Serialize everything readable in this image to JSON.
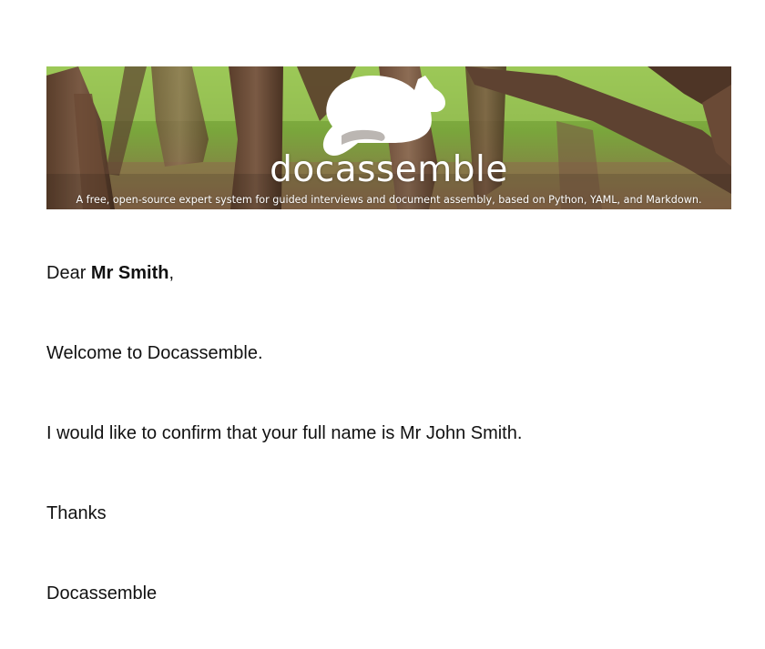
{
  "banner": {
    "logo_icon": "cat-icon",
    "logo_text": "docassemble",
    "tagline": "A free, open-source expert system for guided interviews and document assembly, based on Python, YAML, and Markdown."
  },
  "letter": {
    "greeting_prefix": "Dear ",
    "recipient": "Mr Smith",
    "greeting_suffix": ",",
    "welcome": "Welcome to Docassemble.",
    "confirm": "I would like to confirm that your full name is Mr John Smith.",
    "closing": "Thanks",
    "signature": "Docassemble"
  }
}
